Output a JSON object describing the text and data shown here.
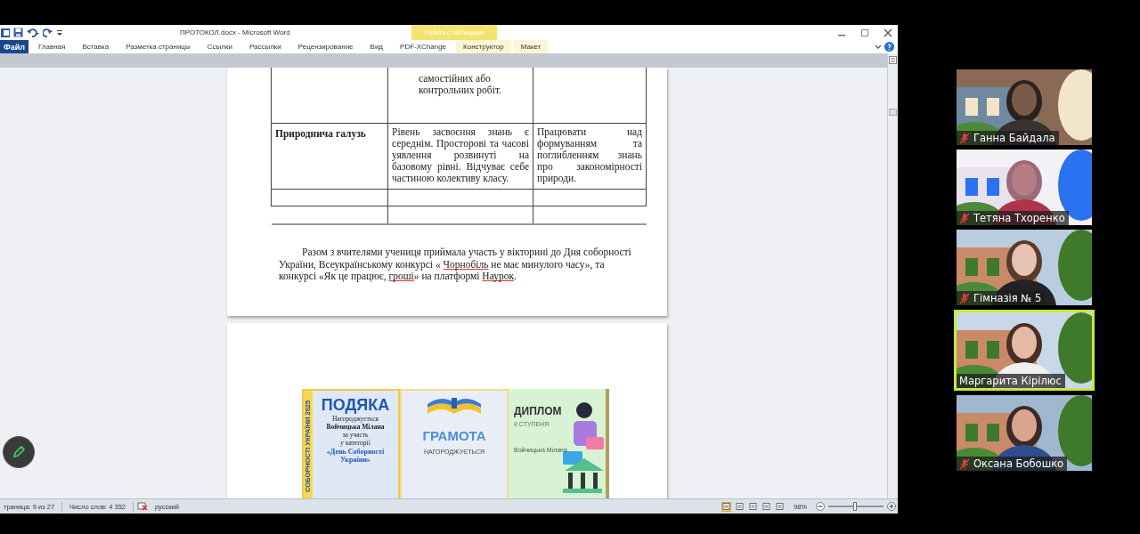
{
  "window": {
    "title": "ПРОТОКОЛ.docx - Microsoft Word",
    "contextual_group": "Работа с таблицами"
  },
  "tabs": [
    {
      "label": "Файл",
      "selected": true,
      "kind": "file"
    },
    {
      "label": "Главная",
      "selected": false,
      "kind": "normal"
    },
    {
      "label": "Вставка",
      "selected": false,
      "kind": "normal"
    },
    {
      "label": "Разметка страницы",
      "selected": false,
      "kind": "normal"
    },
    {
      "label": "Ссылки",
      "selected": false,
      "kind": "normal"
    },
    {
      "label": "Рассылки",
      "selected": false,
      "kind": "normal"
    },
    {
      "label": "Рецензирование",
      "selected": false,
      "kind": "normal"
    },
    {
      "label": "Вид",
      "selected": false,
      "kind": "normal"
    },
    {
      "label": "PDF-XChange",
      "selected": false,
      "kind": "normal"
    },
    {
      "label": "Конструктор",
      "selected": false,
      "kind": "contextual"
    },
    {
      "label": "Макет",
      "selected": false,
      "kind": "contextual"
    }
  ],
  "document": {
    "table_rows": [
      {
        "cells": [
          {
            "text": "",
            "kind": "header"
          },
          {
            "text": "самостійних або контрольних робіт.",
            "kind": "indented"
          },
          {
            "text": "",
            "kind": "body"
          }
        ]
      },
      {
        "cells": [
          {
            "text": "Природнича галузь",
            "kind": "header"
          },
          {
            "text": "Рівень засвоєння знань є середнім. Просторові та часові уявлення розвинуті на базовому рівні. Відчуває себе частиною колективу класу.",
            "kind": "body"
          },
          {
            "text": "Працювати над формуванням та поглибленням знань про закономірності природи.",
            "kind": "body"
          }
        ]
      },
      {
        "cells": [
          {
            "text": "",
            "kind": "body"
          },
          {
            "text": "",
            "kind": "body"
          },
          {
            "text": "",
            "kind": "body"
          }
        ]
      }
    ],
    "paragraph": [
      {
        "text": "Разом з вчителями учениця приймала участь у вікторині до Дня соборності України, Всеукраїнському конкурсі « ",
        "misspelled": false
      },
      {
        "text": "Чорнобіль",
        "misspelled": true
      },
      {
        "text": " не має минулого часу», та конкурсі «Як це працює, ",
        "misspelled": false
      },
      {
        "text": "гроші",
        "misspelled": true
      },
      {
        "text": "» на платформі ",
        "misspelled": false
      },
      {
        "text": "Наурок",
        "misspelled": true
      },
      {
        "text": ".",
        "misspelled": false
      }
    ],
    "certificates": [
      {
        "kind": "podyaka",
        "side": "СОБОРНОСТІ УКРАЇНИ 2025",
        "title": "ПОДЯКА",
        "lines": [
          "Нагороджується",
          "Войчицька Мілана",
          "за участь",
          "у категорії",
          "«День Соборності України»"
        ]
      },
      {
        "kind": "gramota",
        "title": "ГРАМОТА",
        "lines": [
          "НАГОРОДЖУЄТЬСЯ"
        ]
      },
      {
        "kind": "dyplom",
        "title": "ДИПЛОМ",
        "lines": [
          "ІІ СТУПЕНЯ",
          "Войчицька Мілана"
        ]
      }
    ]
  },
  "status_bar": {
    "page": "траница: 9 из 27",
    "words": "Число слов: 4 352",
    "language": "русский",
    "view_buttons": [
      {
        "selected": true
      },
      {
        "selected": false
      },
      {
        "selected": false
      },
      {
        "selected": false
      },
      {
        "selected": false
      }
    ],
    "zoom": "98%",
    "zoom_slider": {
      "level": 0.48
    }
  },
  "participants": [
    {
      "name": "Ганна Байдала",
      "muted": true,
      "speaking": false
    },
    {
      "name": "Тетяна Тхоренко",
      "muted": true,
      "speaking": false
    },
    {
      "name": "Гімназія № 5",
      "muted": true,
      "speaking": false
    },
    {
      "name": "Маргарита Кірілюс",
      "muted": false,
      "speaking": true
    },
    {
      "name": "Оксана Бобошко",
      "muted": true,
      "speaking": false
    }
  ]
}
